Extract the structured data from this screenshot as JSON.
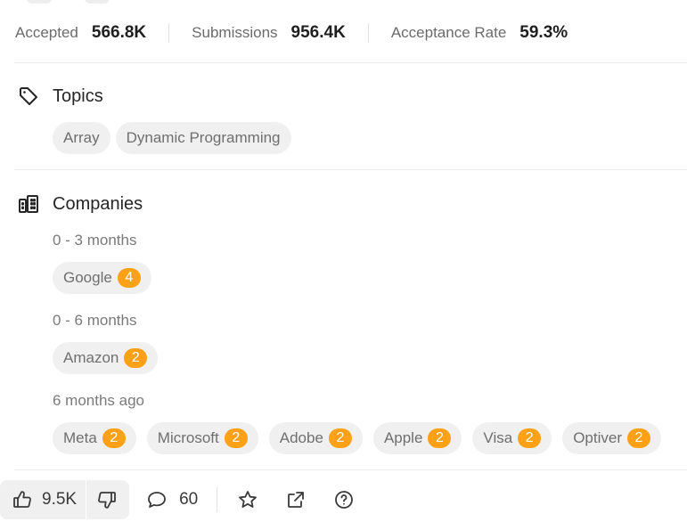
{
  "stats": [
    {
      "label": "Accepted",
      "value": "566.8K"
    },
    {
      "label": "Submissions",
      "value": "956.4K"
    },
    {
      "label": "Acceptance Rate",
      "value": "59.3%"
    }
  ],
  "topics": {
    "title": "Topics",
    "icon": "tag-icon",
    "tags": [
      "Array",
      "Dynamic Programming"
    ]
  },
  "companies": {
    "title": "Companies",
    "icon": "building-icon",
    "groups": [
      {
        "period": "0 - 3 months",
        "items": [
          {
            "name": "Google",
            "count": "4"
          }
        ]
      },
      {
        "period": "0 - 6 months",
        "items": [
          {
            "name": "Amazon",
            "count": "2"
          }
        ]
      },
      {
        "period": "6 months ago",
        "items": [
          {
            "name": "Meta",
            "count": "2"
          },
          {
            "name": "Microsoft",
            "count": "2"
          },
          {
            "name": "Adobe",
            "count": "2"
          },
          {
            "name": "Apple",
            "count": "2"
          },
          {
            "name": "Visa",
            "count": "2"
          },
          {
            "name": "Optiver",
            "count": "2"
          }
        ]
      }
    ]
  },
  "footer": {
    "likes": "9.5K",
    "comments": "60",
    "icons": [
      "thumbs-up-icon",
      "thumbs-down-icon",
      "comment-icon",
      "star-icon",
      "share-icon",
      "help-icon"
    ]
  },
  "colors": {
    "badge": "#ffa116",
    "chip_bg": "#f0f0f0",
    "divider": "#ececec"
  }
}
